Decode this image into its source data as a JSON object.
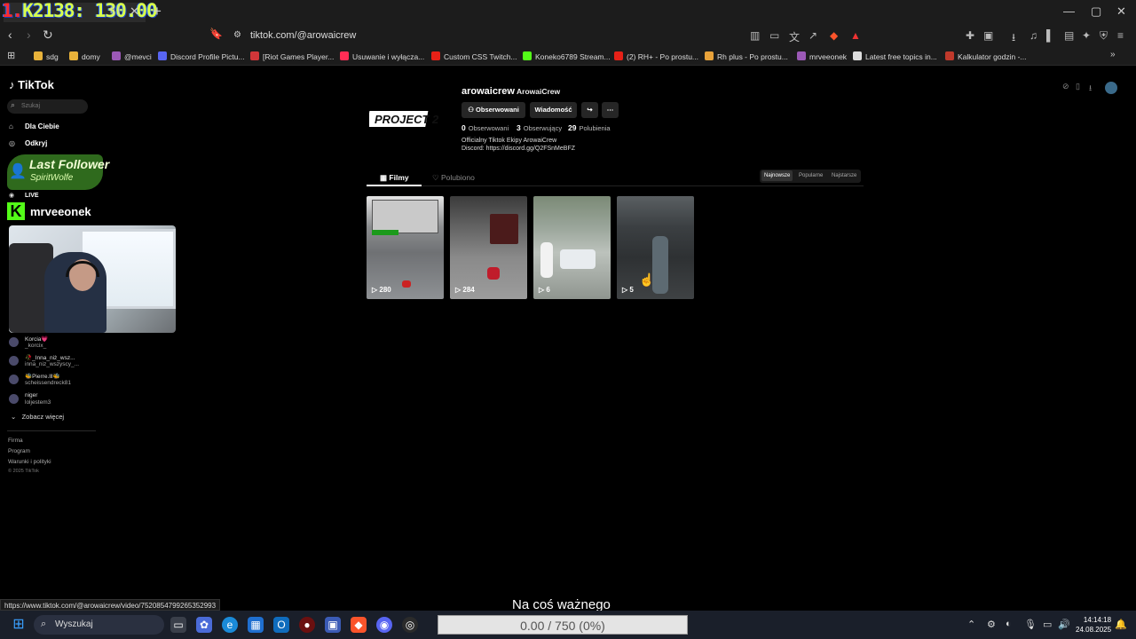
{
  "overlay": {
    "prefix": "1.",
    "counter": "K2138: 130.00"
  },
  "tab": {
    "title_tail": "l) |",
    "close": "✕",
    "new": "+"
  },
  "window_controls": {
    "minimize": "—",
    "maximize": "▢",
    "close": "✕"
  },
  "address": {
    "url": "tiktok.com/@arowaicrew"
  },
  "bookmarks": [
    {
      "label": "sdg",
      "color": "#e8b23a"
    },
    {
      "label": "domy",
      "color": "#e8b23a"
    },
    {
      "label": "@mevci",
      "color": "#9b59b6"
    },
    {
      "label": "Discord Profile Pictu...",
      "color": "#5865f2"
    },
    {
      "label": "[Riot Games Player...",
      "color": "#d13639"
    },
    {
      "label": "Usuwanie i wyłącza...",
      "color": "#ff2d55"
    },
    {
      "label": "Custom CSS Twitch...",
      "color": "#e62117"
    },
    {
      "label": "Koneko6789 Stream...",
      "color": "#53fc18"
    },
    {
      "label": "(2) RH+ - Po prostu...",
      "color": "#e62117"
    },
    {
      "label": "Rh plus - Po prostu...",
      "color": "#e8a23a"
    },
    {
      "label": "mrveeonek",
      "color": "#9b59b6"
    },
    {
      "label": "Latest free topics in...",
      "color": "#dddddd"
    },
    {
      "label": "Kalkulator godzin -...",
      "color": "#c0392b"
    }
  ],
  "tiktok": {
    "logo": "TikTok",
    "search_placeholder": "Szukaj",
    "nav": [
      {
        "label": "Dla Ciebie",
        "icon": "home-icon"
      },
      {
        "label": "Odkryj",
        "icon": "compass-icon"
      }
    ],
    "live_label": "LIVE",
    "following": [
      {
        "line1": "Korcia💗",
        "line2": "_korcix_"
      },
      {
        "line1": "🥀_Inna_niż_wsz...",
        "line2": "inna_niz_wszyscy_..."
      },
      {
        "line1": "🐝Pierre.lll🐝",
        "line2": "scheissendreck81"
      },
      {
        "line1": "niger",
        "line2": "loljestem3"
      }
    ],
    "see_more": "Zobacz więcej",
    "footer": [
      "Firma",
      "Program",
      "Warunki i polityki",
      "© 2025 TikTok"
    ]
  },
  "last_follower": {
    "title": "Last Follower",
    "name": "SpiritWolfe"
  },
  "kick": {
    "logo": "K",
    "name": "mrveeonek"
  },
  "profile": {
    "logo_text": "PROJECT 2",
    "username": "arowaicrew",
    "nickname": "ArowaiCrew",
    "follow_btn": "Obserwowani",
    "message_btn": "Wiadomość",
    "stats": [
      {
        "value": "0",
        "label": "Obserwowani"
      },
      {
        "value": "3",
        "label": "Obserwujący"
      },
      {
        "value": "29",
        "label": "Polubienia"
      }
    ],
    "bio1": "Officialny Tiktok Ekipy ArowaiCrew",
    "bio2": "Discord: https://discord.gg/Q2FSnMeBFZ",
    "tabs": [
      "Filmy",
      "Polubiono"
    ],
    "sort": [
      "Najnowsze",
      "Popularne",
      "Najstarsze"
    ],
    "videos": [
      {
        "views": "280"
      },
      {
        "views": "284"
      },
      {
        "views": "6"
      },
      {
        "views": "5"
      }
    ]
  },
  "status_url": "https://www.tiktok.com/@arowaicrew/video/7520854799265352993",
  "caption": "Na coś ważnego",
  "taskbar": {
    "search": "Wyszukaj",
    "time": "14:14:18",
    "date": "24.08.2025"
  },
  "progress": {
    "text": "0.00 / 750 (0%)",
    "fraction": 0
  },
  "colors": {
    "accent_green": "#53fc18",
    "background": "#000000"
  }
}
